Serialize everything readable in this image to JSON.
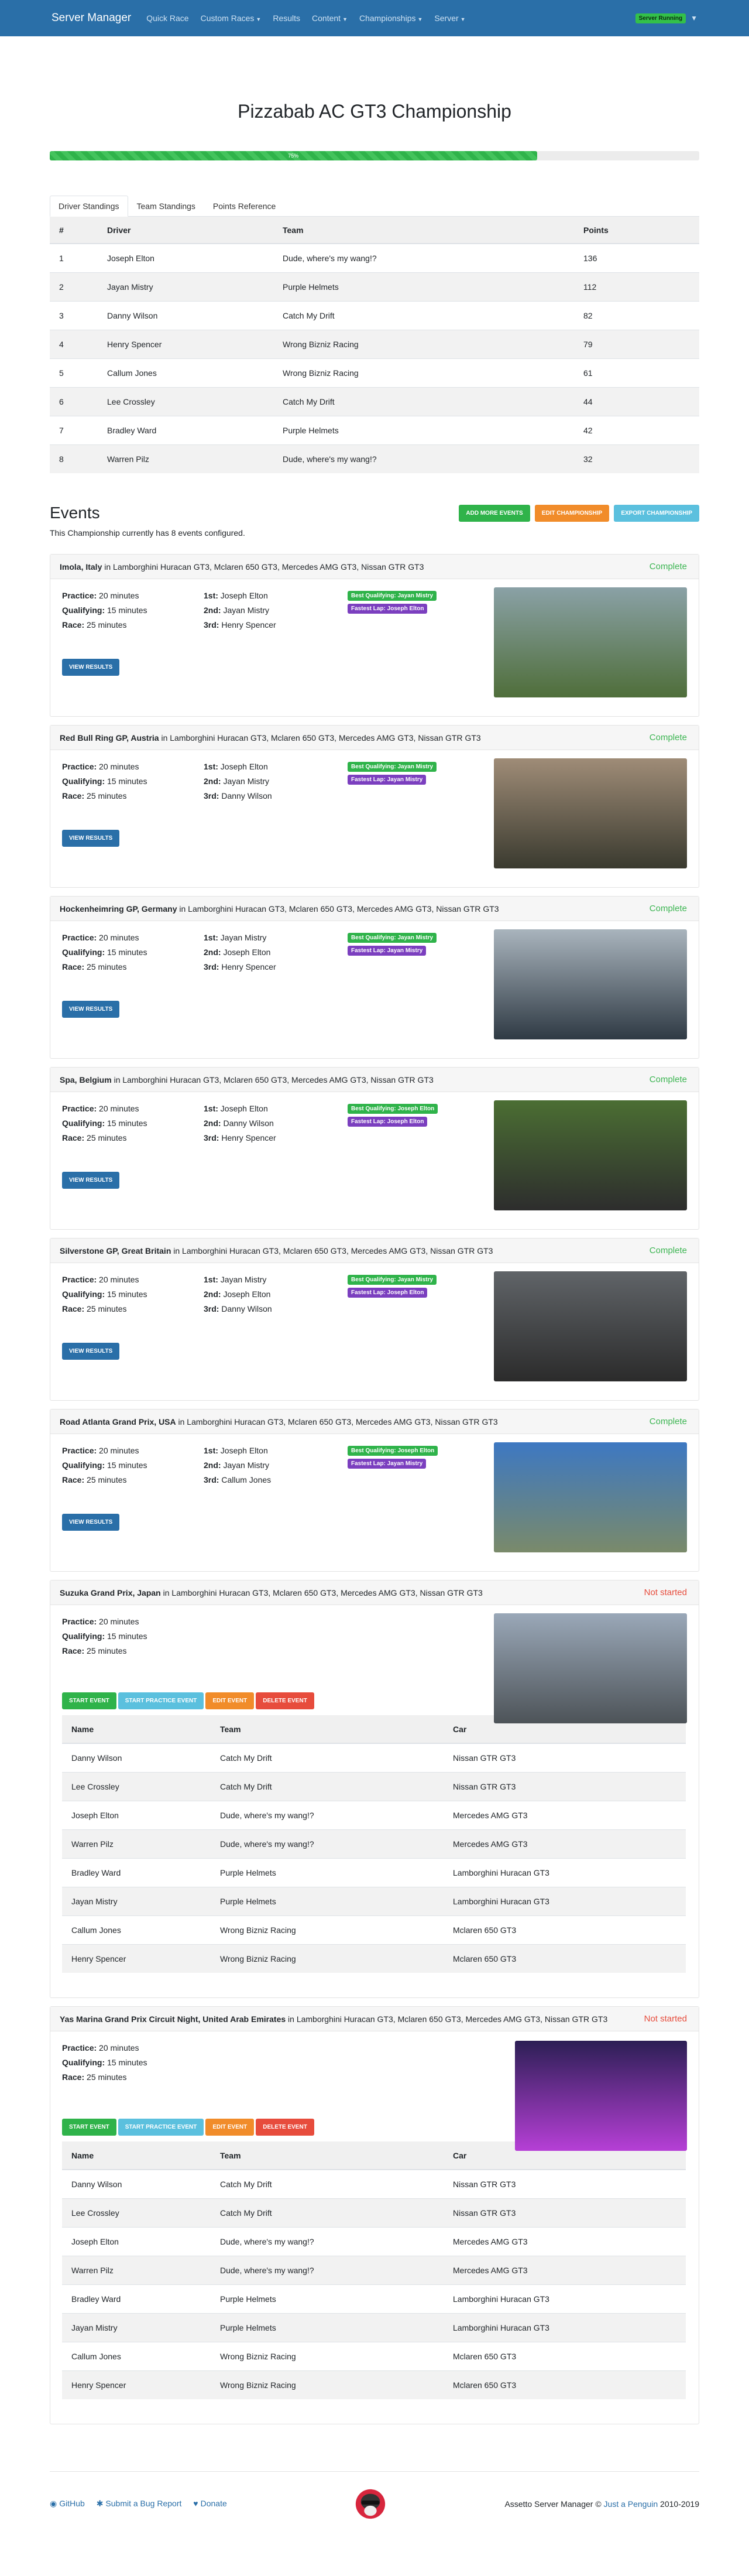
{
  "nav": {
    "brand": "Server Manager",
    "items": [
      "Quick Race",
      "Custom Races",
      "Results",
      "Content",
      "Championships",
      "Server"
    ],
    "dropdown_items": [
      false,
      true,
      false,
      true,
      true,
      true
    ],
    "status_badge": "Server Running",
    "colors": {
      "navbar": "#2a6fa8",
      "accent_green": "#2fb34a"
    }
  },
  "title": "Pizzabab AC GT3 Championship",
  "progress": {
    "percent": 75,
    "label": "75%"
  },
  "tabs": [
    "Driver Standings",
    "Team Standings",
    "Points Reference"
  ],
  "standings": {
    "headers": [
      "#",
      "Driver",
      "Team",
      "Points"
    ],
    "rows": [
      [
        "1",
        "Joseph Elton",
        "Dude, where's my wang!?",
        "136"
      ],
      [
        "2",
        "Jayan Mistry",
        "Purple Helmets",
        "112"
      ],
      [
        "3",
        "Danny Wilson",
        "Catch My Drift",
        "82"
      ],
      [
        "4",
        "Henry Spencer",
        "Wrong Bizniz Racing",
        "79"
      ],
      [
        "5",
        "Callum Jones",
        "Wrong Bizniz Racing",
        "61"
      ],
      [
        "6",
        "Lee Crossley",
        "Catch My Drift",
        "44"
      ],
      [
        "7",
        "Bradley Ward",
        "Purple Helmets",
        "42"
      ],
      [
        "8",
        "Warren Pilz",
        "Dude, where's my wang!?",
        "32"
      ]
    ]
  },
  "events_section": {
    "title": "Events",
    "note": "This Championship currently has 8 events configured.",
    "buttons": {
      "add": "Add more events",
      "edit": "Edit Championship",
      "export": "Export Championship"
    }
  },
  "session_labels": {
    "practice": "Practice:",
    "qualifying": "Qualifying:",
    "race": "Race:"
  },
  "session_values": {
    "practice": "20 minutes",
    "qualifying": "15 minutes",
    "race": "25 minutes"
  },
  "place_labels": [
    "1st:",
    "2nd:",
    "3rd:"
  ],
  "cars_text": "in Lamborghini Huracan GT3, Mclaren 650 GT3, Mercedes AMG GT3, Nissan GTR GT3",
  "buttons": {
    "view_results": "View Results",
    "start": "Start Event",
    "practice": "Start Practice Event",
    "edit": "Edit Event",
    "delete": "Delete Event"
  },
  "entrant_headers": [
    "Name",
    "Team",
    "Car"
  ],
  "entrants": [
    [
      "Danny Wilson",
      "Catch My Drift",
      "Nissan GTR GT3"
    ],
    [
      "Lee Crossley",
      "Catch My Drift",
      "Nissan GTR GT3"
    ],
    [
      "Joseph Elton",
      "Dude, where's my wang!?",
      "Mercedes AMG GT3"
    ],
    [
      "Warren Pilz",
      "Dude, where's my wang!?",
      "Mercedes AMG GT3"
    ],
    [
      "Bradley Ward",
      "Purple Helmets",
      "Lamborghini Huracan GT3"
    ],
    [
      "Jayan Mistry",
      "Purple Helmets",
      "Lamborghini Huracan GT3"
    ],
    [
      "Callum Jones",
      "Wrong Bizniz Racing",
      "Mclaren 650 GT3"
    ],
    [
      "Henry Spencer",
      "Wrong Bizniz Racing",
      "Mclaren 650 GT3"
    ]
  ],
  "completed_events": [
    {
      "track": "Imola, Italy",
      "state": "Complete",
      "first": "Joseph Elton",
      "second": "Jayan Mistry",
      "third": "Henry Spencer",
      "best_quali": "Best Qualifying: Jayan Mistry",
      "fastest_lap": "Fastest Lap: Joseph Elton"
    },
    {
      "track": "Red Bull Ring GP, Austria",
      "state": "Complete",
      "first": "Joseph Elton",
      "second": "Jayan Mistry",
      "third": "Danny Wilson",
      "best_quali": "Best Qualifying: Jayan Mistry",
      "fastest_lap": "Fastest Lap: Jayan Mistry"
    },
    {
      "track": "Hockenheimring GP, Germany",
      "state": "Complete",
      "first": "Jayan Mistry",
      "second": "Joseph Elton",
      "third": "Henry Spencer",
      "best_quali": "Best Qualifying: Jayan Mistry",
      "fastest_lap": "Fastest Lap: Jayan Mistry"
    },
    {
      "track": "Spa, Belgium",
      "state": "Complete",
      "first": "Joseph Elton",
      "second": "Danny Wilson",
      "third": "Henry Spencer",
      "best_quali": "Best Qualifying: Joseph Elton",
      "fastest_lap": "Fastest Lap: Joseph Elton"
    },
    {
      "track": "Silverstone GP, Great Britain",
      "state": "Complete",
      "first": "Jayan Mistry",
      "second": "Joseph Elton",
      "third": "Danny Wilson",
      "best_quali": "Best Qualifying: Jayan Mistry",
      "fastest_lap": "Fastest Lap: Joseph Elton"
    },
    {
      "track": "Road Atlanta Grand Prix, USA",
      "state": "Complete",
      "first": "Joseph Elton",
      "second": "Jayan Mistry",
      "third": "Callum Jones",
      "best_quali": "Best Qualifying: Joseph Elton",
      "fastest_lap": "Fastest Lap: Jayan Mistry"
    }
  ],
  "upcoming_events": [
    {
      "track": "Suzuka Grand Prix, Japan",
      "state": "Not started"
    },
    {
      "track": "Yas Marina Grand Prix Circuit Night, United Arab Emirates",
      "state": "Not started"
    }
  ],
  "footer": {
    "github": "GitHub",
    "bug": "Submit a Bug Report",
    "donate": "Donate",
    "credit_prefix": "Assetto Server Manager ©",
    "credit_link": "Just a Penguin",
    "credit_years": "2010-2019"
  }
}
